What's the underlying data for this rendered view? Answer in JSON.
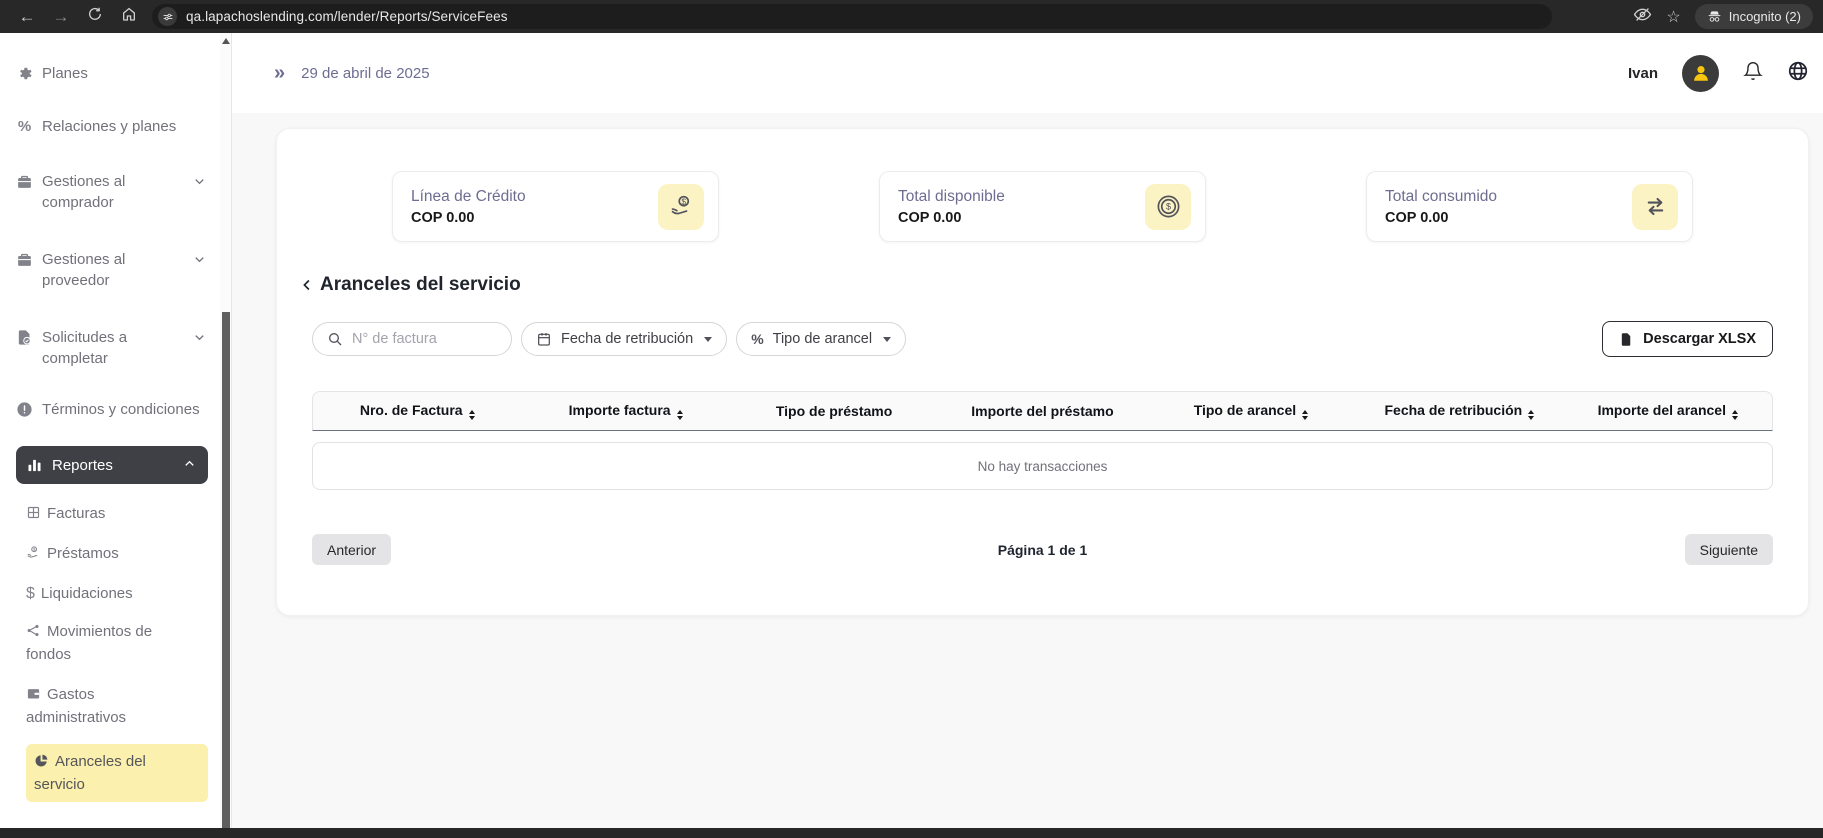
{
  "browser": {
    "url": "qa.lapachoslending.com/lender/Reports/ServiceFees",
    "incognito_label": "Incognito (2)"
  },
  "icons": {
    "back": "←",
    "forward": "→",
    "star": "☆",
    "double_chevron": "»",
    "percent": "%",
    "dollar": "$"
  },
  "header": {
    "date": "29 de abril de 2025",
    "username": "Ivan"
  },
  "sidebar": {
    "items": [
      {
        "label": "Planes"
      },
      {
        "label": "Relaciones y planes"
      },
      {
        "label": "Gestiones al comprador",
        "expandable": true
      },
      {
        "label": "Gestiones al proveedor",
        "expandable": true
      },
      {
        "label": "Solicitudes a completar",
        "expandable": true
      },
      {
        "label": "Términos y condiciones"
      },
      {
        "label": "Reportes",
        "active": true,
        "expanded": true
      }
    ],
    "report_items": [
      {
        "label": "Facturas"
      },
      {
        "label": "Préstamos"
      },
      {
        "label": "Liquidaciones"
      },
      {
        "label": "Movimientos de fondos"
      },
      {
        "label": "Gastos administrativos"
      },
      {
        "label": "Aranceles del servicio",
        "active": true
      }
    ]
  },
  "cards": [
    {
      "title": "Línea de Crédito",
      "value": "COP 0.00",
      "icon": "hand-coin-icon"
    },
    {
      "title": "Total disponible",
      "value": "COP 0.00",
      "icon": "coin-icon"
    },
    {
      "title": "Total consumido",
      "value": "COP 0.00",
      "icon": "transfer-arrows-icon"
    }
  ],
  "section": {
    "title": "Aranceles del servicio"
  },
  "filters": {
    "invoice_search_placeholder": "N° de factura",
    "date_filter_label": "Fecha de retribución",
    "fee_type_filter_label": "Tipo de arancel",
    "download_button_label": "Descargar XLSX"
  },
  "table": {
    "columns": [
      {
        "label": "Nro. de Factura",
        "sortable": true
      },
      {
        "label": "Importe factura",
        "sortable": true
      },
      {
        "label": "Tipo de préstamo",
        "sortable": false
      },
      {
        "label": "Importe del préstamo",
        "sortable": false
      },
      {
        "label": "Tipo de arancel",
        "sortable": true
      },
      {
        "label": "Fecha de retribución",
        "sortable": true
      },
      {
        "label": "Importe del arancel",
        "sortable": true
      }
    ],
    "empty_message": "No hay transacciones"
  },
  "pagination": {
    "previous_label": "Anterior",
    "page_status": "Página 1 de 1",
    "next_label": "Siguiente"
  },
  "colors": {
    "accent_yellow": "#fbf0ad",
    "icon_badge_yellow": "#fcf3c5",
    "active_item_dark": "#3f3f46",
    "avatar_yellow": "#f7c50e",
    "title_purple": "#6d6d92"
  }
}
